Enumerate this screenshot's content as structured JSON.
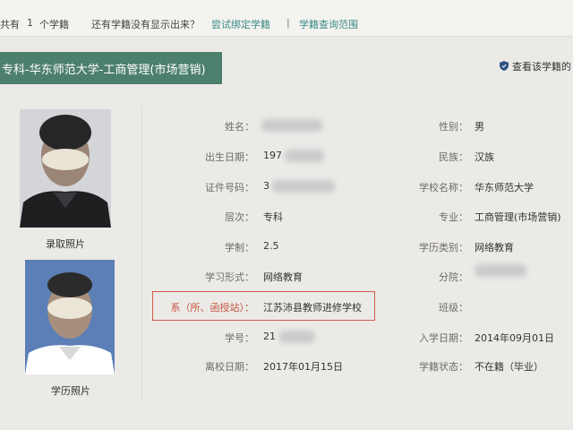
{
  "topbar": {
    "count_prefix": "共有",
    "count_number": "1",
    "count_suffix": "个学籍",
    "missing_question": "还有学籍没有显示出来？",
    "bind_link": "尝试绑定学籍",
    "separator": "|",
    "scope_link": "学籍查询范围"
  },
  "header": {
    "title": "专科-华东师范大学-工商管理(市场营销)"
  },
  "view_link": "查看该学籍的",
  "photos": {
    "admission_caption": "录取照片",
    "degree_caption": "学历照片"
  },
  "fields_left": [
    {
      "label": "姓名：",
      "value": ""
    },
    {
      "label": "出生日期：",
      "value": "197"
    },
    {
      "label": "证件号码：",
      "value": "3"
    },
    {
      "label": "层次：",
      "value": "专科"
    },
    {
      "label": "学制：",
      "value": "2.5"
    },
    {
      "label": "学习形式：",
      "value": "网络教育"
    },
    {
      "label": "系（所、函授站）：",
      "value": "江苏沛县教师进修学校"
    },
    {
      "label": "学号：",
      "value": "21"
    },
    {
      "label": "离校日期：",
      "value": "2017年01月15日"
    }
  ],
  "fields_right": [
    {
      "label": "性别：",
      "value": "男"
    },
    {
      "label": "民族：",
      "value": "汉族"
    },
    {
      "label": "学校名称：",
      "value": "华东师范大学"
    },
    {
      "label": "专业：",
      "value": "工商管理(市场营销)"
    },
    {
      "label": "学历类别：",
      "value": "网络教育"
    },
    {
      "label": "分院：",
      "value": ""
    },
    {
      "label": "班级：",
      "value": ""
    },
    {
      "label": "入学日期：",
      "value": "2014年09月01日"
    },
    {
      "label": "学籍状态：",
      "value": "不在籍（毕业）"
    }
  ],
  "colors": {
    "header_band": "#4d7f6f",
    "accent_link": "#3a8a86",
    "highlight_border": "#d05a4a",
    "shield_icon": "#2f4f82"
  }
}
